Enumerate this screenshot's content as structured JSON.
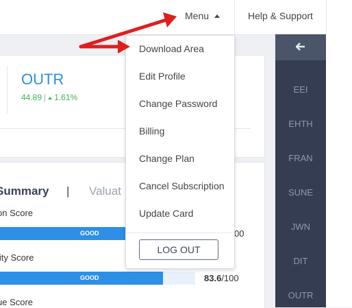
{
  "topbar": {
    "menu_label": "Menu",
    "help_label": "Help & Support"
  },
  "dropdown": {
    "items": [
      "Download Area",
      "Edit Profile",
      "Change Password",
      "Billing",
      "Change Plan",
      "Cancel Subscription",
      "Update Card"
    ],
    "logout_label": "LOG OUT"
  },
  "quote": {
    "ticker": "OUTR",
    "price": "44.89",
    "separator": "|",
    "change": "1.61%"
  },
  "summary": {
    "tab_summary": "Summary",
    "tab_separator": "|",
    "tab_valuation": "Valuat",
    "metrics": [
      {
        "label": "on Score",
        "rating": "GOOD",
        "score_value": "",
        "score_suffix": "00",
        "fill": 0.836
      },
      {
        "label": "lity Score",
        "rating": "GOOD",
        "score_value": "83.6",
        "score_suffix": "/100",
        "fill": 0.836
      },
      {
        "label": "ue Score"
      }
    ]
  },
  "sidebar": {
    "collapse_icon": "arrow-left-icon",
    "tickers": [
      "EEI",
      "EHTH",
      "FRAN",
      "SUNE",
      "JWN",
      "DIT",
      "OUTR"
    ]
  },
  "colors": {
    "accent": "#2d8fe6",
    "positive": "#3cb55a",
    "sidebar_bg": "#343d52",
    "annotation_arrow": "#e01e1e"
  }
}
